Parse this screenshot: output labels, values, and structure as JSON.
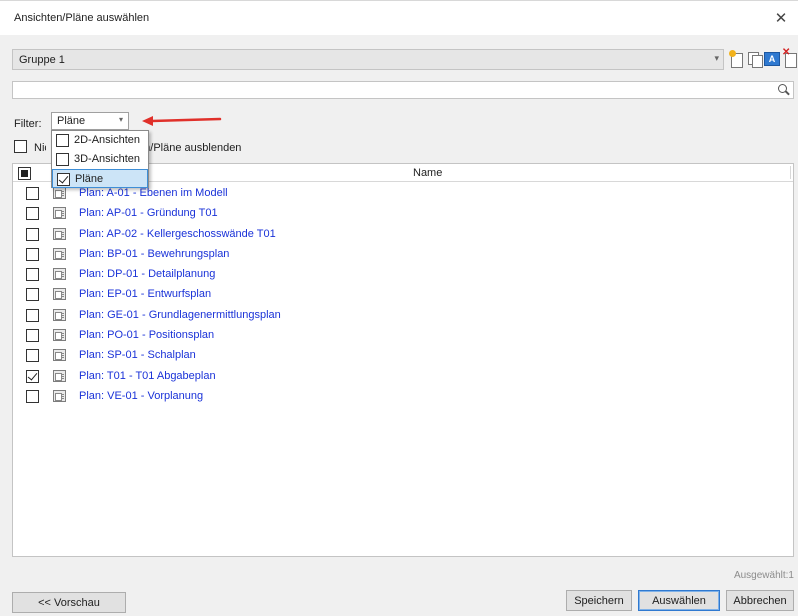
{
  "window": {
    "title": "Ansichten/Pläne auswählen"
  },
  "group": {
    "selected": "Gruppe 1"
  },
  "toolbar": {
    "icons": [
      "new-group-icon",
      "copy-group-icon",
      "rename-group-icon",
      "delete-group-icon"
    ]
  },
  "search": {
    "value": "",
    "placeholder": ""
  },
  "filter": {
    "label": "Filter:",
    "selected": "Pläne",
    "options": [
      {
        "label": "2D-Ansichten",
        "checked": false
      },
      {
        "label": "3D-Ansichten",
        "checked": false
      },
      {
        "label": "Pläne",
        "checked": true
      }
    ]
  },
  "hide_option": {
    "label": "Nicht verwendete Ansichten/Pläne ausblenden",
    "visible_part": "ten/Pläne ausblenden",
    "checked": false
  },
  "list": {
    "header": {
      "name": "Name"
    },
    "items": [
      {
        "name": "Plan: A-01 - Ebenen im Modell",
        "checked": false
      },
      {
        "name": "Plan: AP-01 - Gründung T01",
        "checked": false
      },
      {
        "name": "Plan: AP-02 - Kellergeschosswände T01",
        "checked": false
      },
      {
        "name": "Plan: BP-01 - Bewehrungsplan",
        "checked": false
      },
      {
        "name": "Plan: DP-01 - Detailplanung",
        "checked": false
      },
      {
        "name": "Plan: EP-01 - Entwurfsplan",
        "checked": false
      },
      {
        "name": "Plan: GE-01 - Grundlagenermittlungsplan",
        "checked": false
      },
      {
        "name": "Plan: PO-01 - Positionsplan",
        "checked": false
      },
      {
        "name": "Plan: SP-01 - Schalplan",
        "checked": false
      },
      {
        "name": "Plan: T01 - T01 Abgabeplan",
        "checked": true
      },
      {
        "name": "Plan: VE-01 - Vorplanung",
        "checked": false
      }
    ]
  },
  "status": {
    "selected_count": "Ausgewählt:1"
  },
  "buttons": {
    "preview": "<< Vorschau",
    "save": "Speichern",
    "select": "Auswählen",
    "cancel": "Abbrechen"
  },
  "colors": {
    "link": "#1a32d8",
    "accent": "#2f79d0",
    "arrow": "#e0302a"
  }
}
